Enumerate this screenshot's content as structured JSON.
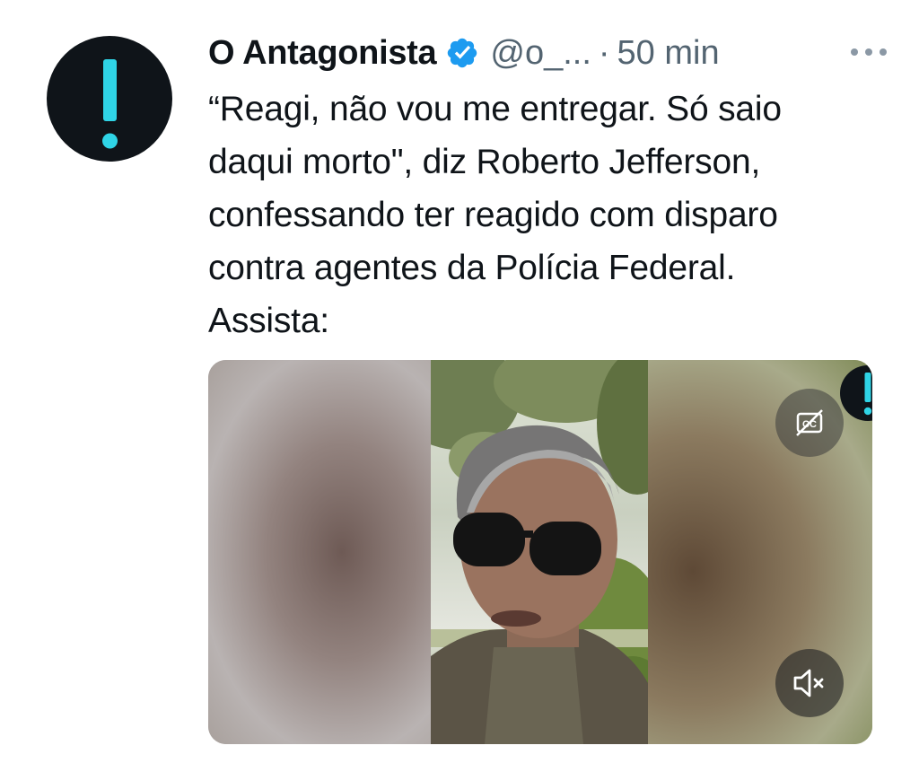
{
  "tweet": {
    "author_name": "O Antagonista",
    "handle": "@o_...",
    "separator": "·",
    "time": "50 min",
    "text": "“Reagi, não vou me entregar. Só saio\ndaqui morto\", diz Roberto Jefferson,\nconfessando ter reagido com disparo\ncontra agentes da Polícia Federal.\nAssista:",
    "verified": true
  },
  "icons": {
    "avatar": "exclamation-logo",
    "verified": "verified-badge-icon",
    "more": "more-icon",
    "captions": "captions-off-icon",
    "mute": "muted-speaker-icon",
    "watermark": "exclamation-logo"
  },
  "colors": {
    "brand_black": "#0f1419",
    "brand_cyan": "#2fd4e6",
    "verified_blue": "#1d9bf0",
    "secondary_text": "#536471"
  },
  "video": {
    "muted": true,
    "captions_enabled": false
  }
}
